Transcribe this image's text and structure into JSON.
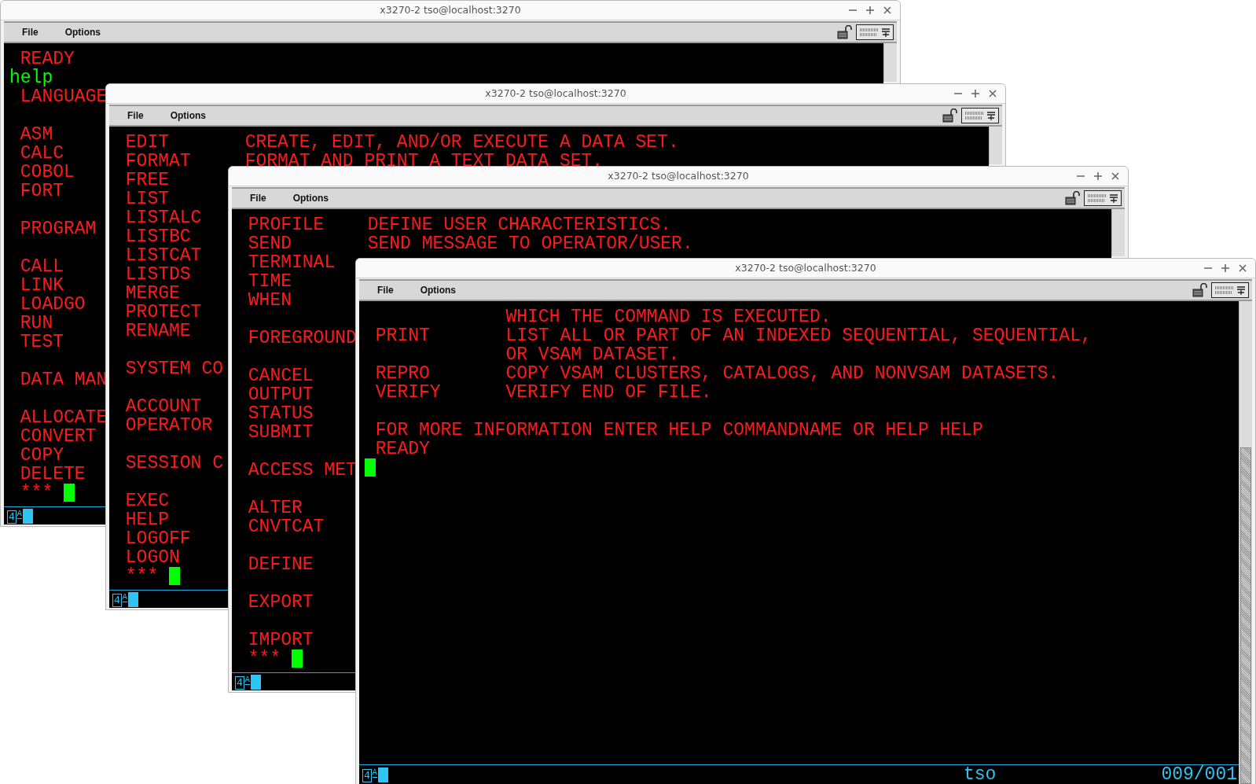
{
  "windows": [
    {
      "title": "x3270-2 tso@localhost:3270",
      "menu": [
        "File",
        "Options"
      ],
      "lines": [
        {
          "kind": "text",
          "command": "READY"
        },
        {
          "kind": "input",
          "text": "help"
        },
        {
          "kind": "text",
          "command": "LANGUAGE"
        },
        {
          "kind": "blank"
        },
        {
          "kind": "text",
          "command": "ASM"
        },
        {
          "kind": "text",
          "command": "CALC"
        },
        {
          "kind": "text",
          "command": "COBOL"
        },
        {
          "kind": "text",
          "command": "FORT"
        },
        {
          "kind": "blank"
        },
        {
          "kind": "text",
          "command": "PROGRAM"
        },
        {
          "kind": "blank"
        },
        {
          "kind": "text",
          "command": "CALL"
        },
        {
          "kind": "text",
          "command": "LINK"
        },
        {
          "kind": "text",
          "command": "LOADGO"
        },
        {
          "kind": "text",
          "command": "RUN"
        },
        {
          "kind": "text",
          "command": "TEST"
        },
        {
          "kind": "blank"
        },
        {
          "kind": "text",
          "command": "DATA MAN"
        },
        {
          "kind": "blank"
        },
        {
          "kind": "text",
          "command": "ALLOCATE"
        },
        {
          "kind": "text",
          "command": "CONVERT"
        },
        {
          "kind": "text",
          "command": "COPY"
        },
        {
          "kind": "text",
          "command": "DELETE"
        },
        {
          "kind": "prompt",
          "text": "***"
        }
      ],
      "status": {
        "indicator": "4",
        "mode": "A"
      }
    },
    {
      "title": "x3270-2 tso@localhost:3270",
      "menu": [
        "File",
        "Options"
      ],
      "lines": [
        {
          "kind": "text",
          "command": "EDIT",
          "description": "CREATE, EDIT, AND/OR EXECUTE A DATA SET."
        },
        {
          "kind": "text",
          "command": "FORMAT",
          "description": "FORMAT AND PRINT A TEXT DATA SET."
        },
        {
          "kind": "text",
          "command": "FREE"
        },
        {
          "kind": "text",
          "command": "LIST"
        },
        {
          "kind": "text",
          "command": "LISTALC"
        },
        {
          "kind": "text",
          "command": "LISTBC"
        },
        {
          "kind": "text",
          "command": "LISTCAT"
        },
        {
          "kind": "text",
          "command": "LISTDS"
        },
        {
          "kind": "text",
          "command": "MERGE"
        },
        {
          "kind": "text",
          "command": "PROTECT"
        },
        {
          "kind": "text",
          "command": "RENAME"
        },
        {
          "kind": "blank"
        },
        {
          "kind": "text",
          "command": "SYSTEM CO"
        },
        {
          "kind": "blank"
        },
        {
          "kind": "text",
          "command": "ACCOUNT"
        },
        {
          "kind": "text",
          "command": "OPERATOR"
        },
        {
          "kind": "blank"
        },
        {
          "kind": "text",
          "command": "SESSION C"
        },
        {
          "kind": "blank"
        },
        {
          "kind": "text",
          "command": "EXEC"
        },
        {
          "kind": "text",
          "command": "HELP"
        },
        {
          "kind": "text",
          "command": "LOGOFF"
        },
        {
          "kind": "text",
          "command": "LOGON"
        },
        {
          "kind": "prompt",
          "text": "***"
        }
      ],
      "status": {
        "indicator": "4",
        "mode": "A"
      }
    },
    {
      "title": "x3270-2 tso@localhost:3270",
      "menu": [
        "File",
        "Options"
      ],
      "lines": [
        {
          "kind": "text",
          "command": "PROFILE",
          "description": "DEFINE USER CHARACTERISTICS."
        },
        {
          "kind": "text",
          "command": "SEND",
          "description": "SEND MESSAGE TO OPERATOR/USER."
        },
        {
          "kind": "text",
          "command": "TERMINAL"
        },
        {
          "kind": "text",
          "command": "TIME"
        },
        {
          "kind": "text",
          "command": "WHEN"
        },
        {
          "kind": "blank"
        },
        {
          "kind": "text",
          "command": "FOREGROUND"
        },
        {
          "kind": "blank"
        },
        {
          "kind": "text",
          "command": "CANCEL"
        },
        {
          "kind": "text",
          "command": "OUTPUT"
        },
        {
          "kind": "text",
          "command": "STATUS"
        },
        {
          "kind": "text",
          "command": "SUBMIT"
        },
        {
          "kind": "blank"
        },
        {
          "kind": "text",
          "command": "ACCESS MET"
        },
        {
          "kind": "blank"
        },
        {
          "kind": "text",
          "command": "ALTER"
        },
        {
          "kind": "text",
          "command": "CNVTCAT"
        },
        {
          "kind": "blank"
        },
        {
          "kind": "text",
          "command": "DEFINE"
        },
        {
          "kind": "blank"
        },
        {
          "kind": "text",
          "command": "EXPORT"
        },
        {
          "kind": "blank"
        },
        {
          "kind": "text",
          "command": "IMPORT"
        },
        {
          "kind": "prompt",
          "text": "***"
        }
      ],
      "status": {
        "indicator": "4",
        "mode": "A"
      }
    },
    {
      "title": "x3270-2 tso@localhost:3270",
      "menu": [
        "File",
        "Options"
      ],
      "lines": [
        {
          "kind": "text",
          "description": "WHICH THE COMMAND IS EXECUTED."
        },
        {
          "kind": "text",
          "command": "PRINT",
          "description": "LIST ALL OR PART OF AN INDEXED SEQUENTIAL, SEQUENTIAL,"
        },
        {
          "kind": "text",
          "description": "OR VSAM DATASET."
        },
        {
          "kind": "text",
          "command": "REPRO",
          "description": "COPY VSAM CLUSTERS, CATALOGS, AND NONVSAM DATASETS."
        },
        {
          "kind": "text",
          "command": "VERIFY",
          "description": "VERIFY END OF FILE."
        },
        {
          "kind": "blank"
        },
        {
          "kind": "text",
          "command": "FOR MORE INFORMATION ENTER HELP COMMANDNAME OR HELP HELP"
        },
        {
          "kind": "text",
          "command": "READY"
        },
        {
          "kind": "cursor"
        }
      ],
      "status": {
        "indicator": "4",
        "mode": "A",
        "user": "tso",
        "position": "009/001"
      }
    }
  ]
}
